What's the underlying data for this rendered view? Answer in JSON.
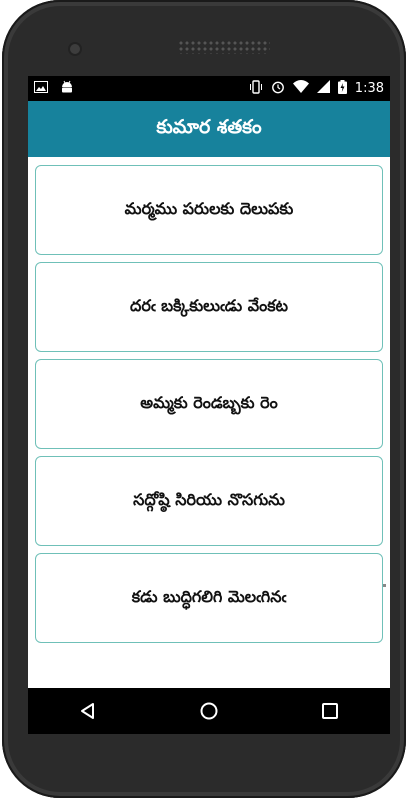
{
  "status_bar": {
    "time": "1:38",
    "icons_left": [
      "image-icon",
      "android-icon"
    ],
    "icons_right": [
      "vibrate-icon",
      "alarm-icon",
      "wifi-icon",
      "signal-icon",
      "battery-charging-icon"
    ]
  },
  "app_bar": {
    "title": "కుమార శతకం",
    "color": "#17829c"
  },
  "list": {
    "items": [
      {
        "label": "మర్మము పరులకు దెలుపకు"
      },
      {
        "label": "దరఁ బక్కికులుఁడు వేంకట"
      },
      {
        "label": "అమ్మకు రెండబ్బకు రెం"
      },
      {
        "label": "సద్గోష్ఠి సిరియు నొసగును"
      },
      {
        "label": "కడు బుద్ధిగలిగి మెలఁగినఁ"
      }
    ],
    "border_color": "#6fc0b8"
  },
  "nav_bar": {
    "buttons": [
      "back-icon",
      "home-icon",
      "recents-icon"
    ]
  }
}
